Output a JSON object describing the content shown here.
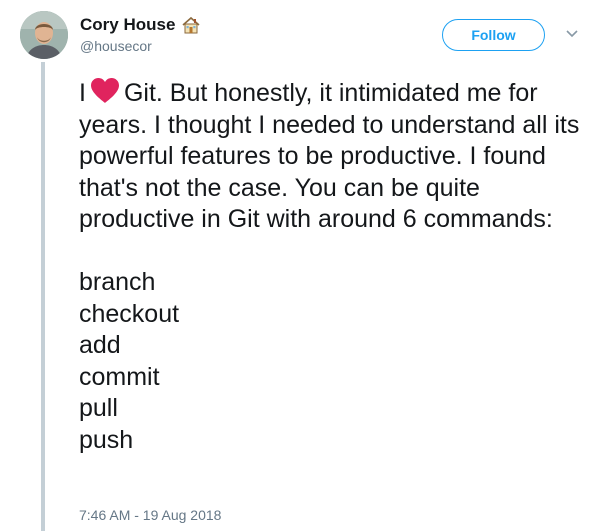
{
  "author": {
    "display_name": "Cory House",
    "handle": "@housecor",
    "badge_icon": "house-icon"
  },
  "follow_label": "Follow",
  "tweet": {
    "prefix": "I",
    "heart_icon": "heart-icon",
    "text_after_heart": "Git. But honestly, it intimidated me for years. I thought I needed to understand all its powerful features to be productive. I found that's not the case. You can be quite productive in Git with around 6 commands:",
    "commands": [
      "branch",
      "checkout",
      "add",
      "commit",
      "pull",
      "push"
    ]
  },
  "timestamp": "7:46 AM - 19 Aug 2018",
  "colors": {
    "accent": "#1da1f2",
    "heart": "#e0245e",
    "secondary_text": "#657786",
    "thread_line": "#c4cfd6"
  }
}
